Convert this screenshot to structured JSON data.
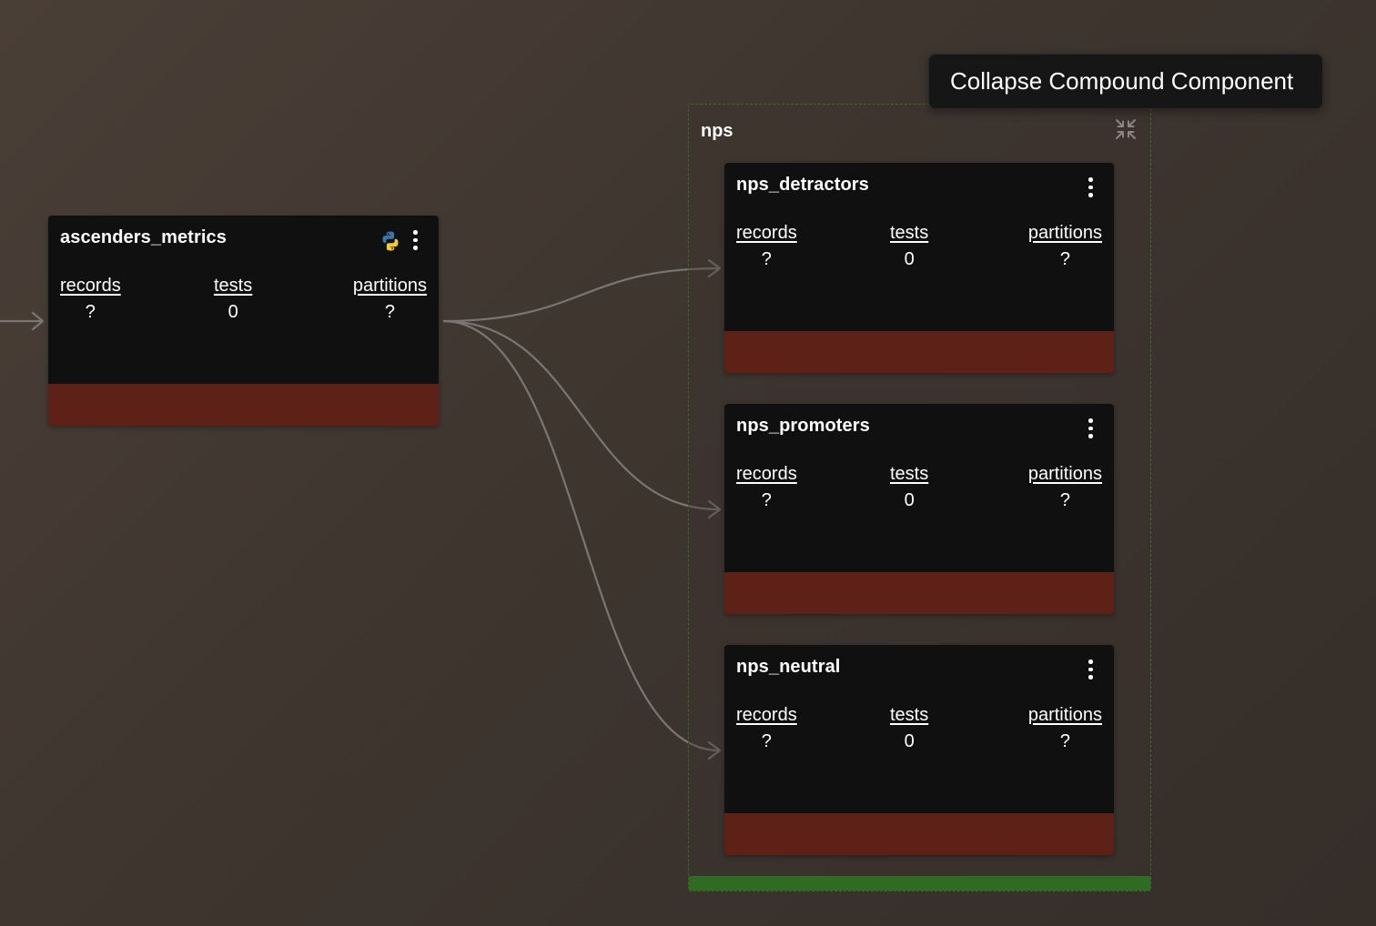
{
  "colors": {
    "node_bg": "#111011",
    "status_bar": "#5e2118",
    "compound_border": "#3d6b2c",
    "compound_bar": "#2f6b23",
    "edge": "#7a7672",
    "tooltip_bg": "#161616"
  },
  "tooltip": {
    "text": "Collapse Compound Component"
  },
  "compound": {
    "title": "nps",
    "collapse_icon": "collapse-arrows-icon"
  },
  "nodes": {
    "ascenders_metrics": {
      "title": "ascenders_metrics",
      "icon": "python-icon",
      "records_label": "records",
      "records_value": "?",
      "tests_label": "tests",
      "tests_value": "0",
      "partitions_label": "partitions",
      "partitions_value": "?"
    },
    "nps_detractors": {
      "title": "nps_detractors",
      "records_label": "records",
      "records_value": "?",
      "tests_label": "tests",
      "tests_value": "0",
      "partitions_label": "partitions",
      "partitions_value": "?"
    },
    "nps_promoters": {
      "title": "nps_promoters",
      "records_label": "records",
      "records_value": "?",
      "tests_label": "tests",
      "tests_value": "0",
      "partitions_label": "partitions",
      "partitions_value": "?"
    },
    "nps_neutral": {
      "title": "nps_neutral",
      "records_label": "records",
      "records_value": "?",
      "tests_label": "tests",
      "tests_value": "0",
      "partitions_label": "partitions",
      "partitions_value": "?"
    }
  }
}
